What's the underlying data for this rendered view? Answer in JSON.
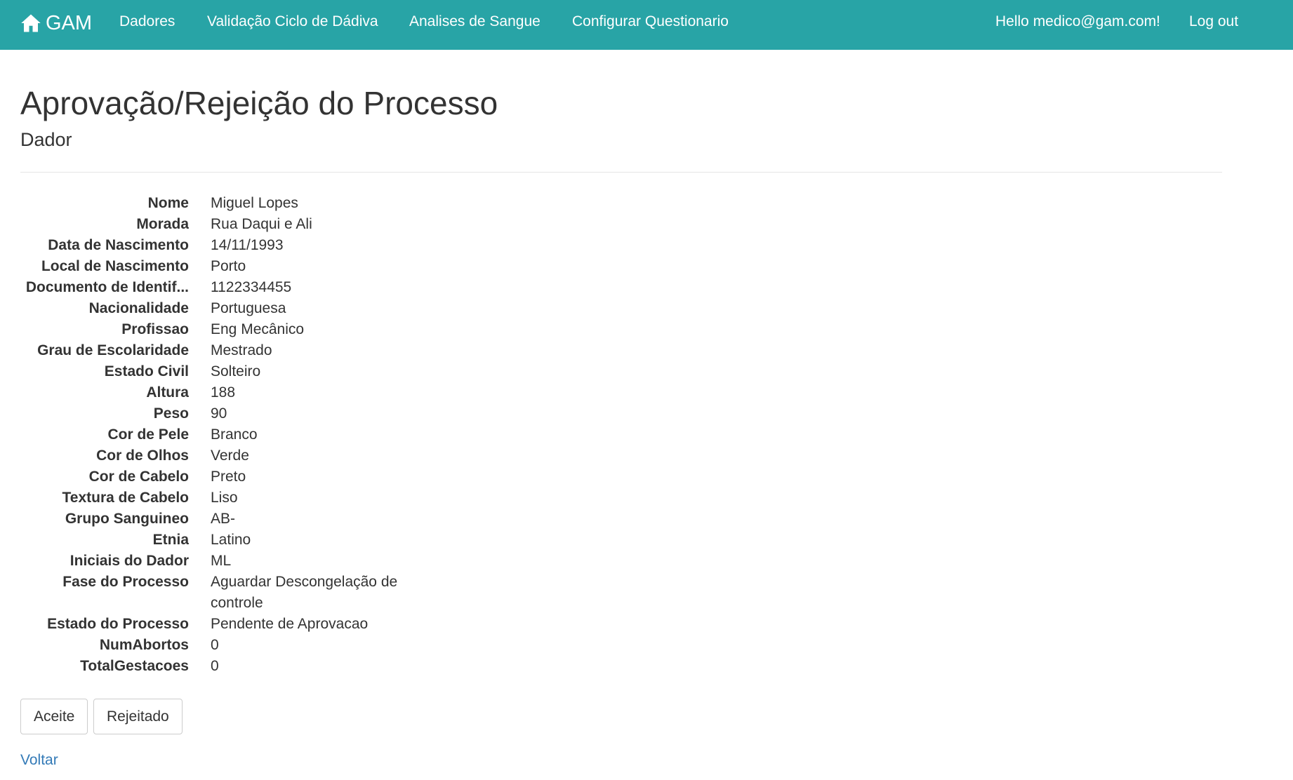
{
  "navbar": {
    "brand": "GAM",
    "brand_icon": "home-icon",
    "links": [
      "Dadores",
      "Validação Ciclo de Dádiva",
      "Analises de Sangue",
      "Configurar Questionario"
    ],
    "greeting": "Hello medico@gam.com!",
    "logout": "Log out",
    "color": "#28a4a6"
  },
  "page": {
    "title": "Aprovação/Rejeição do Processo",
    "section": "Dador"
  },
  "details": [
    {
      "label": "Nome",
      "value": "Miguel Lopes"
    },
    {
      "label": "Morada",
      "value": "Rua Daqui e Ali"
    },
    {
      "label": "Data de Nascimento",
      "value": "14/11/1993"
    },
    {
      "label": "Local de Nascimento",
      "value": "Porto"
    },
    {
      "label": "Documento de Identif...",
      "value": "1122334455"
    },
    {
      "label": "Nacionalidade",
      "value": "Portuguesa"
    },
    {
      "label": "Profissao",
      "value": "Eng Mecânico"
    },
    {
      "label": "Grau de Escolaridade",
      "value": "Mestrado"
    },
    {
      "label": "Estado Civil",
      "value": "Solteiro"
    },
    {
      "label": "Altura",
      "value": "188"
    },
    {
      "label": "Peso",
      "value": "90"
    },
    {
      "label": "Cor de Pele",
      "value": "Branco"
    },
    {
      "label": "Cor de Olhos",
      "value": "Verde"
    },
    {
      "label": "Cor de Cabelo",
      "value": "Preto"
    },
    {
      "label": "Textura de Cabelo",
      "value": "Liso"
    },
    {
      "label": "Grupo Sanguineo",
      "value": "AB-"
    },
    {
      "label": "Etnia",
      "value": "Latino"
    },
    {
      "label": "Iniciais do Dador",
      "value": "ML"
    },
    {
      "label": "Fase do Processo",
      "value": "Aguardar Descongelação de controle"
    },
    {
      "label": "Estado do Processo",
      "value": "Pendente de Aprovacao"
    },
    {
      "label": "NumAbortos",
      "value": "0"
    },
    {
      "label": "TotalGestacoes",
      "value": "0"
    }
  ],
  "actions": {
    "accept": "Aceite",
    "reject": "Rejeitado",
    "back": "Voltar"
  }
}
